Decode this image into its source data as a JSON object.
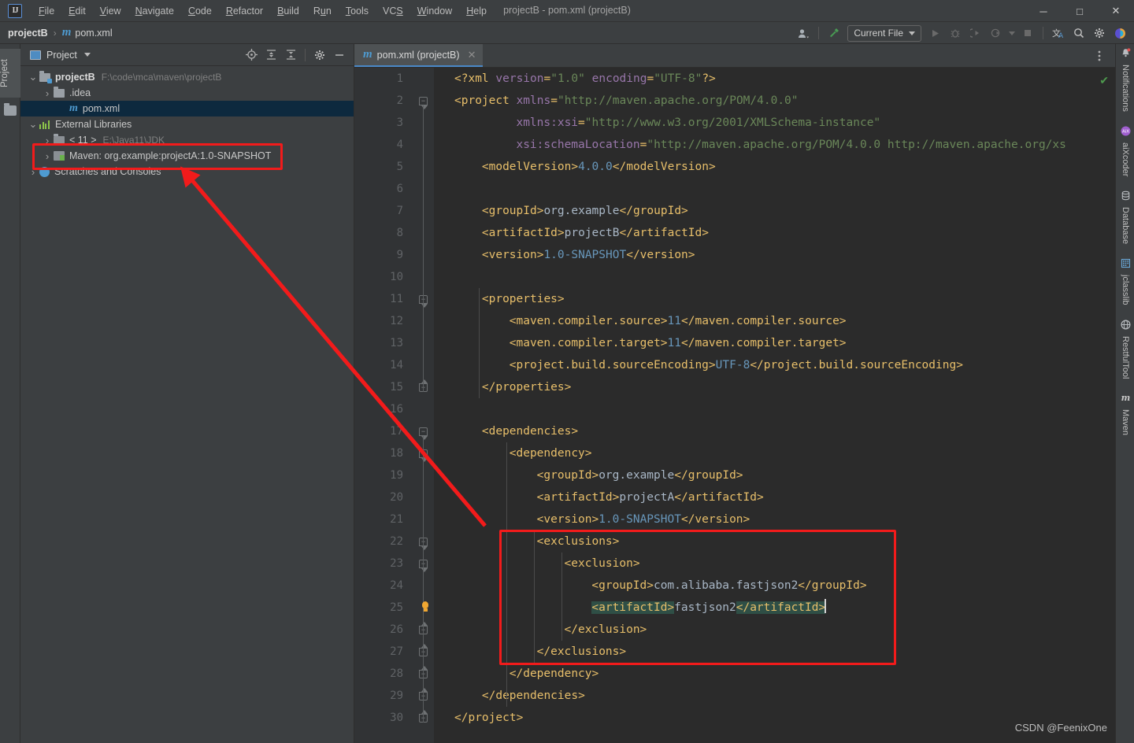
{
  "window": {
    "title": "projectB - pom.xml (projectB)",
    "logo": "intellij-idea-logo",
    "minimize": "─",
    "maximize": "□",
    "close": "✕"
  },
  "menubar": {
    "items": [
      {
        "label": "File",
        "mnemonic": "F"
      },
      {
        "label": "Edit",
        "mnemonic": "E"
      },
      {
        "label": "View",
        "mnemonic": "V"
      },
      {
        "label": "Navigate",
        "mnemonic": "N"
      },
      {
        "label": "Code",
        "mnemonic": "C"
      },
      {
        "label": "Refactor",
        "mnemonic": "R"
      },
      {
        "label": "Build",
        "mnemonic": "B"
      },
      {
        "label": "Run",
        "mnemonic": "u"
      },
      {
        "label": "Tools",
        "mnemonic": "T"
      },
      {
        "label": "VCS",
        "mnemonic": "S"
      },
      {
        "label": "Window",
        "mnemonic": "W"
      },
      {
        "label": "Help",
        "mnemonic": "H"
      }
    ]
  },
  "navbar": {
    "crumb_project": "projectB",
    "crumb_sep": "›",
    "crumb_file": "pom.xml",
    "run_config": "Current File",
    "icons": {
      "profile": "user-avatar-icon",
      "hammer": "build-hammer-icon",
      "run": "run-icon",
      "debug": "debug-icon",
      "coverage": "run-with-coverage-icon",
      "profiler": "profiler-icon",
      "stop": "stop-icon",
      "translate": "translate-icon",
      "search": "search-everywhere-icon",
      "settings": "settings-gear-icon",
      "plugin": "ai-assistant-icon"
    }
  },
  "left_strip": {
    "tab_label": "Project",
    "folder_icon": "folder-icon"
  },
  "project_panel": {
    "header": {
      "title": "Project",
      "dropdown": "▾",
      "tools": [
        "select-opened-file-icon",
        "expand-all-icon",
        "collapse-all-icon",
        "settings-gear-icon",
        "hide-icon"
      ]
    },
    "tree": [
      {
        "label": "projectB",
        "path": "F:\\code\\mca\\maven\\projectB",
        "depth": 0,
        "arrow": "open",
        "icon": "module-folder-icon",
        "bold": true,
        "selected": false
      },
      {
        "label": ".idea",
        "path": "",
        "depth": 1,
        "arrow": "closed",
        "icon": "folder-icon",
        "bold": false,
        "selected": false
      },
      {
        "label": "pom.xml",
        "path": "",
        "depth": 2,
        "arrow": "none",
        "icon": "maven-xml-icon",
        "bold": false,
        "selected": true
      },
      {
        "label": "External Libraries",
        "path": "",
        "depth": 0,
        "arrow": "open",
        "icon": "libraries-icon",
        "bold": false,
        "selected": false
      },
      {
        "label": "< 11 >",
        "path": "E:\\Java11\\JDK",
        "depth": 1,
        "arrow": "closed",
        "icon": "jdk-folder-icon",
        "bold": false,
        "selected": false
      },
      {
        "label": "Maven: org.example:projectA:1.0-SNAPSHOT",
        "path": "",
        "depth": 1,
        "arrow": "closed",
        "icon": "jar-library-icon",
        "bold": false,
        "selected": false
      },
      {
        "label": "Scratches and Consoles",
        "path": "",
        "depth": 0,
        "arrow": "closed",
        "icon": "scratches-icon",
        "bold": false,
        "selected": false
      }
    ]
  },
  "editor": {
    "tab": {
      "label": "pom.xml (projectB)",
      "icon": "maven-xml-icon",
      "close": "✕"
    },
    "tab_options_icon": "more-options-icon",
    "inspection_status": "✔",
    "total_lines": 30,
    "lines": [
      {
        "n": 1,
        "indent": 0,
        "segs": [
          [
            "tag",
            "<?xml "
          ],
          [
            "attrname",
            "version"
          ],
          [
            "tag",
            "="
          ],
          [
            "str",
            "\"1.0\""
          ],
          [
            "tag",
            " "
          ],
          [
            "attrname",
            "encoding"
          ],
          [
            "tag",
            "="
          ],
          [
            "str",
            "\"UTF-8\""
          ],
          [
            "tag",
            "?>"
          ]
        ]
      },
      {
        "n": 2,
        "indent": 0,
        "fold": "top",
        "segs": [
          [
            "tag",
            "<project "
          ],
          [
            "attrname",
            "xmlns"
          ],
          [
            "tag",
            "="
          ],
          [
            "str",
            "\"http://maven.apache.org/POM/4.0.0\""
          ]
        ]
      },
      {
        "n": 3,
        "indent": 9,
        "segs": [
          [
            "attrname",
            "xmlns:xsi"
          ],
          [
            "tag",
            "="
          ],
          [
            "str",
            "\"http://www.w3.org/2001/XMLSchema-instance\""
          ]
        ]
      },
      {
        "n": 4,
        "indent": 9,
        "segs": [
          [
            "attrname",
            "xsi:schemaLocation"
          ],
          [
            "tag",
            "="
          ],
          [
            "str",
            "\"http://maven.apache.org/POM/4.0.0 http://maven.apache.org/xs"
          ]
        ]
      },
      {
        "n": 5,
        "indent": 4,
        "segs": [
          [
            "tag",
            "<modelVersion>"
          ],
          [
            "val",
            "4.0.0"
          ],
          [
            "tag",
            "</modelVersion>"
          ]
        ]
      },
      {
        "n": 6,
        "indent": 0,
        "segs": []
      },
      {
        "n": 7,
        "indent": 4,
        "segs": [
          [
            "tag",
            "<groupId>"
          ],
          [
            "txt",
            "org.example"
          ],
          [
            "tag",
            "</groupId>"
          ]
        ]
      },
      {
        "n": 8,
        "indent": 4,
        "segs": [
          [
            "tag",
            "<artifactId>"
          ],
          [
            "txt",
            "projectB"
          ],
          [
            "tag",
            "</artifactId>"
          ]
        ]
      },
      {
        "n": 9,
        "indent": 4,
        "segs": [
          [
            "tag",
            "<version>"
          ],
          [
            "val",
            "1.0-SNAPSHOT"
          ],
          [
            "tag",
            "</version>"
          ]
        ]
      },
      {
        "n": 10,
        "indent": 0,
        "segs": []
      },
      {
        "n": 11,
        "indent": 4,
        "fold": "top",
        "segs": [
          [
            "tag",
            "<properties>"
          ]
        ]
      },
      {
        "n": 12,
        "indent": 8,
        "segs": [
          [
            "tag",
            "<maven.compiler.source>"
          ],
          [
            "val",
            "11"
          ],
          [
            "tag",
            "</maven.compiler.source>"
          ]
        ]
      },
      {
        "n": 13,
        "indent": 8,
        "segs": [
          [
            "tag",
            "<maven.compiler.target>"
          ],
          [
            "val",
            "11"
          ],
          [
            "tag",
            "</maven.compiler.target>"
          ]
        ]
      },
      {
        "n": 14,
        "indent": 8,
        "segs": [
          [
            "tag",
            "<project.build.sourceEncoding>"
          ],
          [
            "val",
            "UTF-8"
          ],
          [
            "tag",
            "</project.build.sourceEncoding>"
          ]
        ]
      },
      {
        "n": 15,
        "indent": 4,
        "fold": "bot",
        "segs": [
          [
            "tag",
            "</properties>"
          ]
        ]
      },
      {
        "n": 16,
        "indent": 0,
        "segs": []
      },
      {
        "n": 17,
        "indent": 4,
        "fold": "top",
        "segs": [
          [
            "tag",
            "<dependencies>"
          ]
        ]
      },
      {
        "n": 18,
        "indent": 8,
        "fold": "top",
        "segs": [
          [
            "tag",
            "<dependency>"
          ]
        ]
      },
      {
        "n": 19,
        "indent": 12,
        "segs": [
          [
            "tag",
            "<groupId>"
          ],
          [
            "txt",
            "org.example"
          ],
          [
            "tag",
            "</groupId>"
          ]
        ]
      },
      {
        "n": 20,
        "indent": 12,
        "segs": [
          [
            "tag",
            "<artifactId>"
          ],
          [
            "txt",
            "projectA"
          ],
          [
            "tag",
            "</artifactId>"
          ]
        ]
      },
      {
        "n": 21,
        "indent": 12,
        "segs": [
          [
            "tag",
            "<version>"
          ],
          [
            "val",
            "1.0-SNAPSHOT"
          ],
          [
            "tag",
            "</version>"
          ]
        ]
      },
      {
        "n": 22,
        "indent": 12,
        "fold": "top",
        "segs": [
          [
            "tag",
            "<exclusions>"
          ]
        ]
      },
      {
        "n": 23,
        "indent": 16,
        "fold": "top",
        "segs": [
          [
            "tag",
            "<exclusion>"
          ]
        ]
      },
      {
        "n": 24,
        "indent": 20,
        "segs": [
          [
            "tag",
            "<groupId>"
          ],
          [
            "txt",
            "com.alibaba.fastjson2"
          ],
          [
            "tag",
            "</groupId>"
          ]
        ]
      },
      {
        "n": 25,
        "indent": 20,
        "bulb": true,
        "caret": true,
        "segs": [
          [
            "tag hl",
            "<artifactId>"
          ],
          [
            "txt",
            "fastjson2"
          ],
          [
            "tag hl",
            "</artifactId>"
          ]
        ]
      },
      {
        "n": 26,
        "indent": 16,
        "fold": "bot",
        "segs": [
          [
            "tag",
            "</exclusion>"
          ]
        ]
      },
      {
        "n": 27,
        "indent": 12,
        "fold": "bot",
        "segs": [
          [
            "tag",
            "</exclusions>"
          ]
        ]
      },
      {
        "n": 28,
        "indent": 8,
        "fold": "bot",
        "segs": [
          [
            "tag",
            "</dependency>"
          ]
        ]
      },
      {
        "n": 29,
        "indent": 4,
        "fold": "bot",
        "segs": [
          [
            "tag",
            "</dependencies>"
          ]
        ]
      },
      {
        "n": 30,
        "indent": 0,
        "fold": "bot",
        "segs": [
          [
            "tag",
            "</project>"
          ]
        ]
      }
    ]
  },
  "right_strip": {
    "tabs": [
      {
        "label": "Notifications",
        "icon": "notifications-bell-icon"
      },
      {
        "label": "aiXcoder",
        "icon": "aixcoder-icon"
      },
      {
        "label": "Database",
        "icon": "database-icon"
      },
      {
        "label": "jclasslib",
        "icon": "jclasslib-icon"
      },
      {
        "label": "RestfulTool",
        "icon": "restfultool-icon"
      },
      {
        "label": "Maven",
        "icon": "maven-icon"
      }
    ]
  },
  "watermark": "CSDN @FeenixOne",
  "annotations": {
    "highlight_color": "#f21b1b",
    "tree_box": "Maven: org.example:projectA:1.0-SNAPSHOT",
    "code_box": "exclusions block lines 22-27",
    "arrow": "arrow-annotation"
  },
  "colors": {
    "editor_bg": "#2b2b2b",
    "panel_bg": "#3c3f41",
    "gutter_bg": "#313335",
    "tag": "#e8bf6a",
    "string": "#6a8759",
    "attr_name": "#9876aa",
    "text": "#a9b7c6",
    "number": "#6897bb",
    "selection": "#2f4f46",
    "tree_selection": "#0d293e",
    "accent": "#4a88c7"
  }
}
